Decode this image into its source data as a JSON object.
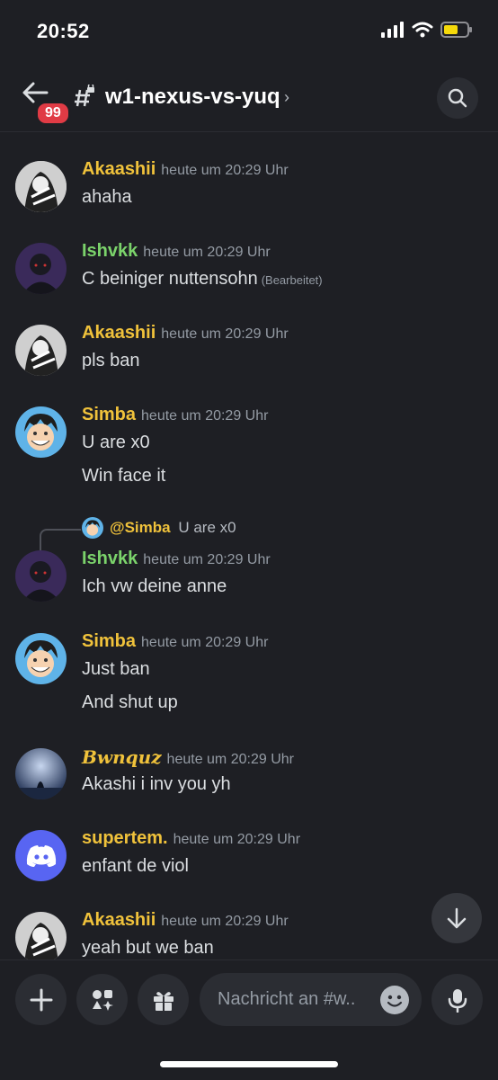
{
  "status_bar": {
    "time": "20:52"
  },
  "header": {
    "unread_count": "99",
    "channel_name": "w1-nexus-vs-yuq"
  },
  "messages": [
    {
      "user": "Akaashii",
      "user_color": "#f0c23b",
      "timestamp": "heute um 20:29 Uhr",
      "lines": [
        "ahaha"
      ]
    },
    {
      "user": "Ishvkk",
      "user_color": "#7bd36b",
      "timestamp": "heute um 20:29 Uhr",
      "lines": [
        "C beiniger nuttensohn"
      ],
      "edited": "(Bearbeitet)"
    },
    {
      "user": "Akaashii",
      "user_color": "#f0c23b",
      "timestamp": "heute um 20:29 Uhr",
      "lines": [
        "pls ban"
      ]
    },
    {
      "user": "Simba",
      "user_color": "#f0c23b",
      "timestamp": "heute um 20:29 Uhr",
      "lines": [
        "U are x0",
        "Win face it"
      ]
    },
    {
      "reply": {
        "mention": "@Simba",
        "text": "U are x0"
      },
      "user": "Ishvkk",
      "user_color": "#7bd36b",
      "timestamp": "heute um 20:29 Uhr",
      "lines": [
        "Ich vw deine anne"
      ]
    },
    {
      "user": "Simba",
      "user_color": "#f0c23b",
      "timestamp": "heute um 20:29 Uhr",
      "lines": [
        "Just ban",
        "And shut up"
      ]
    },
    {
      "user": "Bwnquz",
      "user_color": "#f0c23b",
      "timestamp": "heute um 20:29 Uhr",
      "lines": [
        "Akashi i inv you yh"
      ]
    },
    {
      "user": "supertem.",
      "user_color": "#f0c23b",
      "timestamp": "heute um 20:29 Uhr",
      "lines": [
        "enfant de viol"
      ]
    },
    {
      "user": "Akaashii",
      "user_color": "#f0c23b",
      "timestamp": "heute um 20:29 Uhr",
      "lines": [
        "yeah but we ban"
      ]
    }
  ],
  "composer": {
    "placeholder": "Nachricht an #w.."
  },
  "icons": {
    "back": "arrow-left-icon",
    "channel": "hash-lock-icon",
    "search": "search-icon",
    "scroll": "arrow-down-icon",
    "add": "plus-icon",
    "apps": "apps-icon",
    "gift": "gift-icon",
    "emoji": "emoji-icon",
    "mic": "microphone-icon"
  }
}
